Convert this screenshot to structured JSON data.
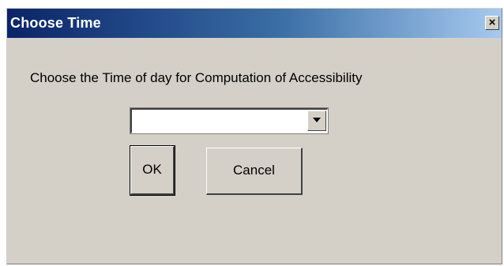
{
  "window": {
    "title": "Choose Time",
    "close_label": "×"
  },
  "dialog": {
    "prompt": "Choose the Time of day for Computation of Accessibility",
    "time_select": {
      "selected_value": ""
    },
    "ok_label": "OK",
    "cancel_label": "Cancel"
  },
  "colors": {
    "titlebar_start": "#0a246a",
    "titlebar_end": "#a6caf0",
    "face": "#d4d0c8"
  },
  "icons": {
    "combo_arrow": "chevron-down-icon",
    "close": "close-icon"
  }
}
